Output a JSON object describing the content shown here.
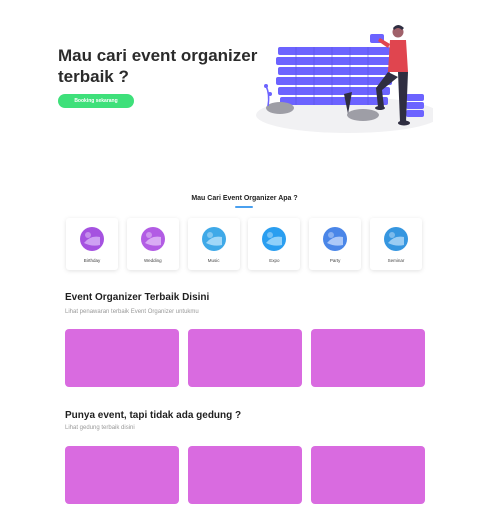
{
  "hero": {
    "title": "Mau cari event organizer terbaik ?",
    "cta_label": "Booking sekarang"
  },
  "categories": {
    "heading": "Mau Cari Event Organizer Apa ?",
    "items": [
      {
        "label": "Birthday",
        "icon": "birthday-icon",
        "color": "#a552e0"
      },
      {
        "label": "Wedding",
        "icon": "wedding-icon",
        "color": "#b25ce4"
      },
      {
        "label": "Music",
        "icon": "music-icon",
        "color": "#3fa9e8"
      },
      {
        "label": "Expo",
        "icon": "expo-icon",
        "color": "#2a9ef0"
      },
      {
        "label": "Party",
        "icon": "party-icon",
        "color": "#4a86e8"
      },
      {
        "label": "Seminar",
        "icon": "seminar-icon",
        "color": "#3596e0"
      }
    ]
  },
  "eo_section": {
    "title": "Event Organizer Terbaik Disini",
    "subtitle": "Lihat penawaran terbaik Event Organizer untukmu"
  },
  "venue_section": {
    "title": "Punya event, tapi tidak ada gedung ?",
    "subtitle": "Lihat gedung terbaik disini"
  },
  "colors": {
    "accent_green": "#3ee07a",
    "card_placeholder": "#d96be0",
    "illustration_purple": "#6c63ff",
    "underline_blue": "#4aa0ef"
  }
}
